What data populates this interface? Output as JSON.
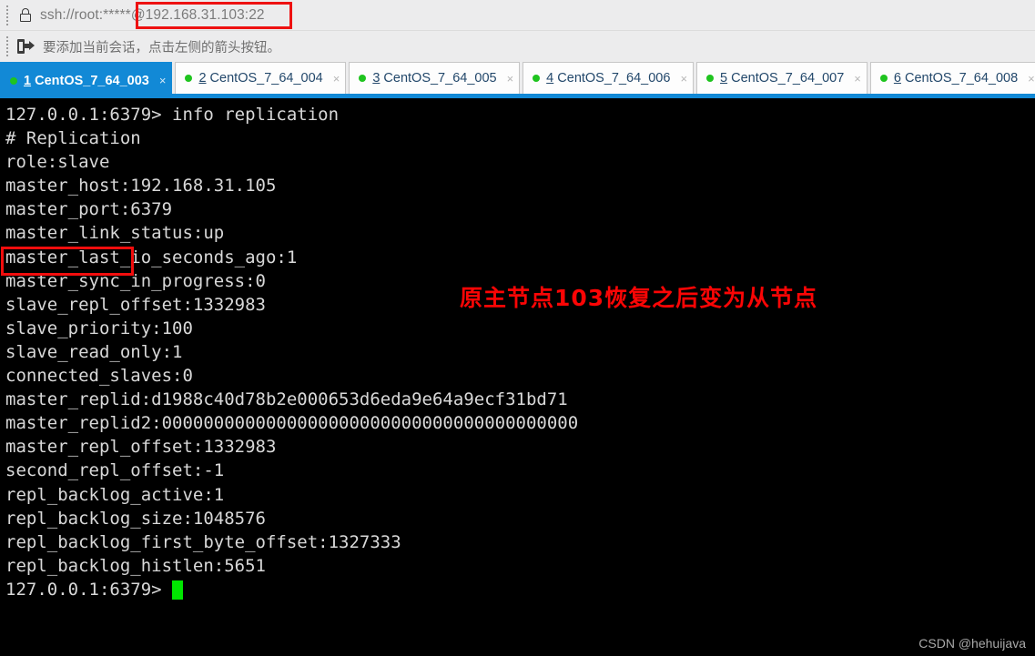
{
  "toolbar": {
    "grip_icon": "drag-grip-icon",
    "lock_icon": "lock-icon",
    "address": "ssh://root:*****@192.168.31.103:22",
    "address_prefix": "ssh://root:*****",
    "address_host": "@192.168.31.103:22",
    "add_session_icon": "add-session-arrow-icon",
    "hint": "要添加当前会话，点击左侧的箭头按钮。"
  },
  "tabs": [
    {
      "index": "1",
      "name": "CentOS_7_64_003",
      "status_color": "#1fc41f",
      "active": true,
      "close": "×"
    },
    {
      "index": "2",
      "name": "CentOS_7_64_004",
      "status_color": "#1fc41f",
      "active": false,
      "close": "×"
    },
    {
      "index": "3",
      "name": "CentOS_7_64_005",
      "status_color": "#1fc41f",
      "active": false,
      "close": "×"
    },
    {
      "index": "4",
      "name": "CentOS_7_64_006",
      "status_color": "#1fc41f",
      "active": false,
      "close": "×"
    },
    {
      "index": "5",
      "name": "CentOS_7_64_007",
      "status_color": "#1fc41f",
      "active": false,
      "close": "×"
    },
    {
      "index": "6",
      "name": "CentOS_7_64_008",
      "status_color": "#1fc41f",
      "active": false,
      "close": "×"
    }
  ],
  "terminal": {
    "lines": [
      "127.0.0.1:6379> info replication",
      "# Replication",
      "role:slave",
      "master_host:192.168.31.105",
      "master_port:6379",
      "master_link_status:up",
      "master_last_io_seconds_ago:1",
      "master_sync_in_progress:0",
      "slave_repl_offset:1332983",
      "slave_priority:100",
      "slave_read_only:1",
      "connected_slaves:0",
      "master_replid:d1988c40d78b2e000653d6eda9e64a9ecf31bd71",
      "master_replid2:0000000000000000000000000000000000000000",
      "master_repl_offset:1332983",
      "second_repl_offset:-1",
      "repl_backlog_active:1",
      "repl_backlog_size:1048576",
      "repl_backlog_first_byte_offset:1327333",
      "repl_backlog_histlen:5651"
    ],
    "prompt": "127.0.0.1:6379>",
    "cursor": "block-cursor",
    "text_color": "#d8d8d8",
    "background_color": "#000000",
    "cursor_color": "#00e600"
  },
  "annotations": {
    "highlight_color": "#f20d0d",
    "note_text": "原主节点103恢复之后变为从节点",
    "highlight_address_target": "@192.168.31.103:22",
    "highlight_role_target": "role:slave"
  },
  "watermark": "CSDN @hehuijava"
}
